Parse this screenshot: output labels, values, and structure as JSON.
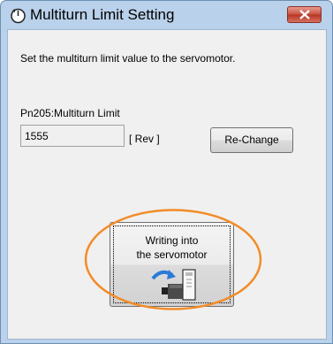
{
  "window": {
    "title": "Multiturn Limit Setting",
    "icons": {
      "app": "servo-dial-icon",
      "close": "close-icon"
    }
  },
  "main": {
    "instruction": "Set the multiturn limit value to the servomotor.",
    "parameter_label": "Pn205:Multiturn Limit",
    "value": "1555",
    "unit": "[ Rev ]",
    "rechange_label": "Re-Change",
    "write_button": {
      "line1": "Writing into",
      "line2": "the servomotor",
      "icon": "write-to-servomotor-icon"
    }
  },
  "colors": {
    "highlight": "#f28c28",
    "close_button": "#c75040",
    "frame": "#b9d1ea"
  }
}
